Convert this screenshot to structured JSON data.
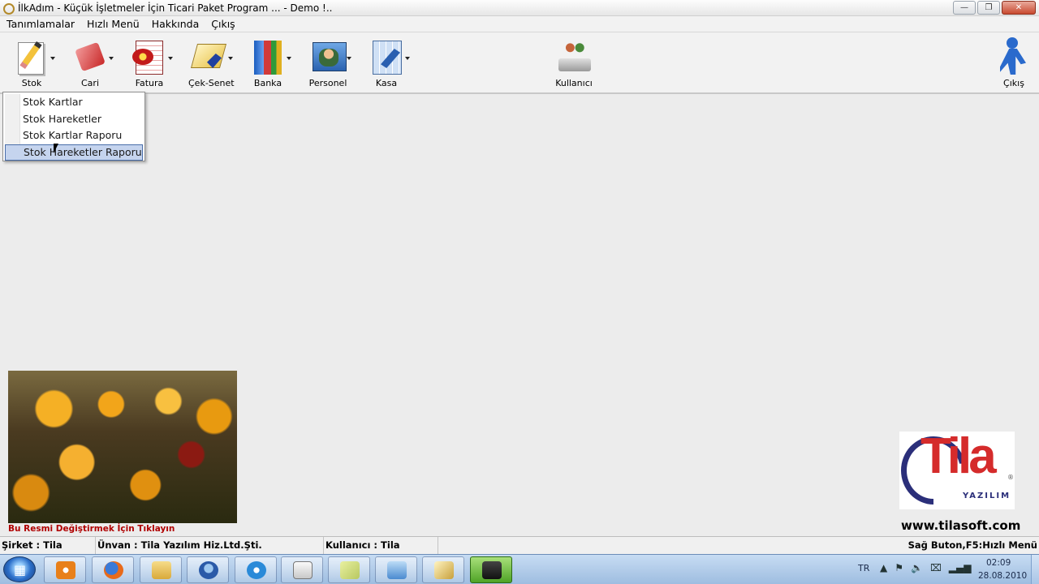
{
  "window": {
    "title": "İlkAdım - Küçük İşletmeler İçin Ticari Paket Program ... - Demo !..",
    "minimize": "—",
    "maximize": "❐",
    "close": "✕"
  },
  "menubar": {
    "items": [
      {
        "label": "Tanımlamalar"
      },
      {
        "label": "Hızlı Menü"
      },
      {
        "label": "Hakkında"
      },
      {
        "label": "Çıkış"
      }
    ]
  },
  "toolbar": {
    "stok": "Stok",
    "cari": "Cari",
    "fatura": "Fatura",
    "cek_senet": "Çek-Senet",
    "banka": "Banka",
    "personel": "Personel",
    "kasa": "Kasa",
    "kullanici": "Kullanıcı",
    "cikis": "Çıkış"
  },
  "dropdown": {
    "items": [
      {
        "label": "Stok Kartlar"
      },
      {
        "label": "Stok Hareketler"
      },
      {
        "label": "Stok Kartlar Raporu"
      },
      {
        "label": "Stok Hareketler Raporu"
      }
    ]
  },
  "workspace": {
    "photo_caption": "Bu Resmi Değiştirmek İçin Tıklayın",
    "logo_word": "Tila",
    "logo_sub": "YAZILIM",
    "logo_reg": "®",
    "website": "www.tilasoft.com"
  },
  "statusbar": {
    "sirket": "Şirket : Tila",
    "unvan": "Ünvan : Tila Yazılım Hiz.Ltd.Şti.",
    "kullanici": "Kullanıcı : Tila",
    "hint": "Sağ Buton,F5:Hızlı Menü"
  },
  "taskbar": {
    "lang": "TR",
    "time": "02:09",
    "date": "28.08.2010",
    "tray_icons": [
      "▲",
      "⚑",
      "🔈",
      "⌧",
      "▂▄▆"
    ]
  }
}
